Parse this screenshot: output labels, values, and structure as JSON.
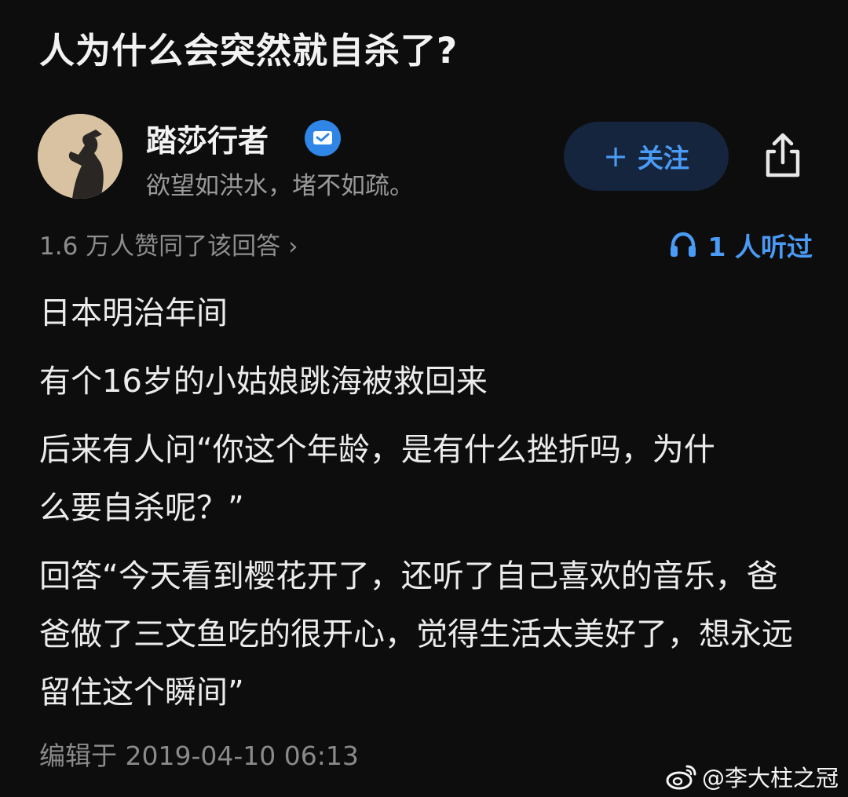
{
  "question": {
    "title": "人为什么会突然就自杀了?"
  },
  "author": {
    "name": "踏莎行者",
    "bio": "欲望如洪水，堵不如疏。",
    "avatar_icon": "avatar-silhouette",
    "verified_icon": "verified-badge-icon"
  },
  "actions": {
    "follow_plus": "+",
    "follow_label": "关注",
    "share_icon": "share-icon"
  },
  "meta": {
    "agree_text": "1.6 万人赞同了该回答",
    "agree_chevron": "›",
    "listened_text": "1 人听过",
    "listened_icon": "headphone-icon"
  },
  "answer": {
    "paragraphs": [
      "日本明治年间",
      "有个16岁的小姑娘跳海被救回来",
      "后来有人问“你这个年龄，是有什么挫折吗，为什么要自杀呢？”",
      "回答“今天看到樱花开了，还听了自己喜欢的音乐，爸爸做了三文鱼吃的很开心，觉得生活太美好了，想永远留住这个瞬间”"
    ],
    "edited": "编辑于 2019-04-10 06:13"
  },
  "watermark": {
    "text": "@李大柱之冠",
    "icon": "weibo-icon"
  },
  "colors": {
    "background": "#0d0d0d",
    "accent": "#4a9bf5",
    "follow_bg": "#15253e",
    "muted": "#8d8d8d"
  }
}
